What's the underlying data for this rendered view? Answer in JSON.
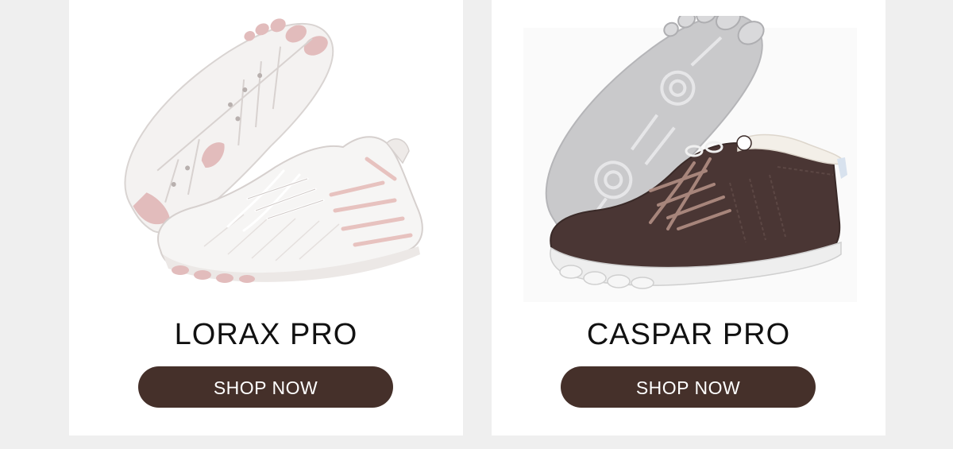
{
  "products": [
    {
      "name": "LORAX PRO",
      "button_label": "SHOP NOW",
      "image_icon": "shoe-image-white-pink"
    },
    {
      "name": "CASPAR PRO",
      "button_label": "SHOP NOW",
      "image_icon": "shoe-image-brown-boot"
    }
  ],
  "colors": {
    "page_background": "#efefef",
    "card_background": "#ffffff",
    "button_background": "#45302a",
    "button_text": "#ffffff",
    "title_text": "#111111"
  }
}
